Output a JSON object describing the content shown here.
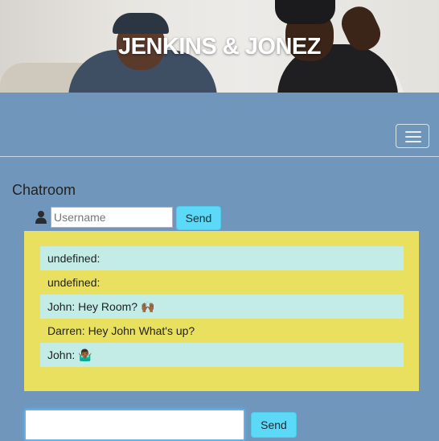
{
  "hero": {
    "title": "JENKINS & JONEZ"
  },
  "navbar": {
    "toggle_icon": "hamburger-icon"
  },
  "chat": {
    "heading": "Chatroom",
    "username_placeholder": "Username",
    "username_value": "",
    "user_icon": "user-icon",
    "send_label": "Send",
    "messages": [
      "undefined:",
      "undefined:",
      "John: Hey Room? 🙌🏾",
      "Darren: Hey John What's up?",
      "John: 🤷🏾‍♂"
    ],
    "message_input_value": "",
    "send2_label": "Send"
  },
  "colors": {
    "page_bg": "#7097bb",
    "messages_bg": "#e8e05e",
    "message_alt_bg": "#c3ece6",
    "button_bg": "#5bd9f6"
  }
}
